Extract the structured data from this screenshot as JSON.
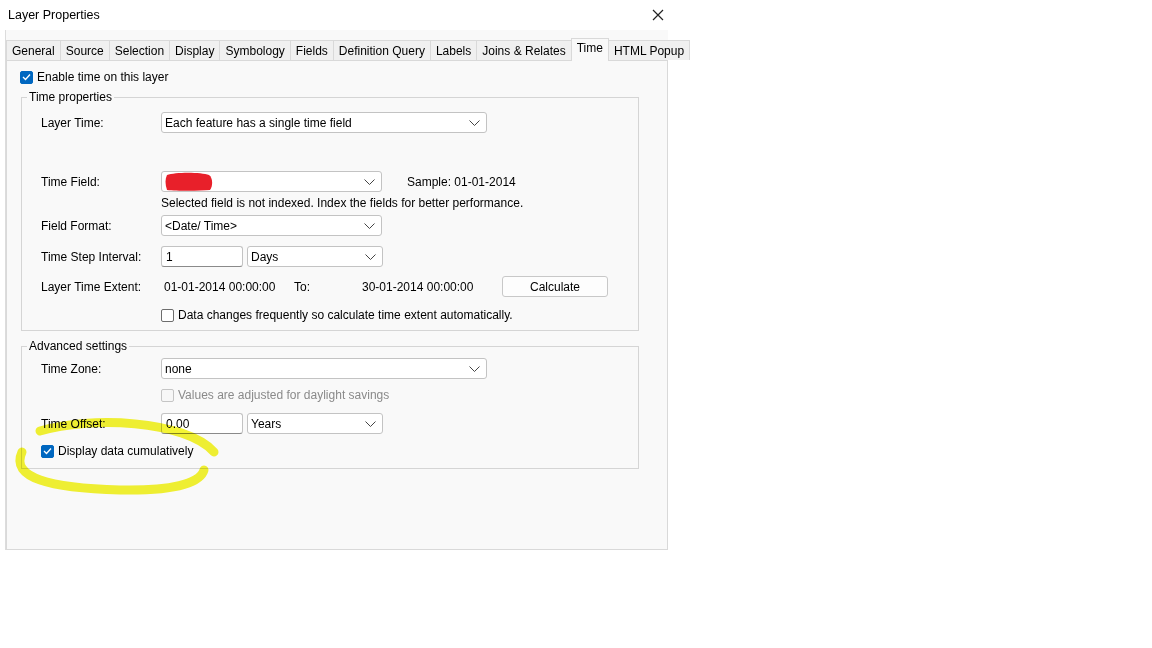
{
  "window": {
    "title": "Layer Properties"
  },
  "tabs": [
    {
      "label": "General",
      "selected": false
    },
    {
      "label": "Source",
      "selected": false
    },
    {
      "label": "Selection",
      "selected": false
    },
    {
      "label": "Display",
      "selected": false
    },
    {
      "label": "Symbology",
      "selected": false
    },
    {
      "label": "Fields",
      "selected": false
    },
    {
      "label": "Definition Query",
      "selected": false
    },
    {
      "label": "Labels",
      "selected": false
    },
    {
      "label": "Joins & Relates",
      "selected": false
    },
    {
      "label": "Time",
      "selected": true
    },
    {
      "label": "HTML Popup",
      "selected": false
    }
  ],
  "enable_time": {
    "label": "Enable time on this layer",
    "checked": true
  },
  "time_properties": {
    "title": "Time properties",
    "layer_time": {
      "label": "Layer Time:",
      "value": "Each feature has a single time field"
    },
    "time_field": {
      "label": "Time Field:",
      "value_redacted": true,
      "sample": "Sample: 01-01-2014",
      "note": "Selected field is not indexed. Index the fields for better performance."
    },
    "field_format": {
      "label": "Field Format:",
      "value": "<Date/ Time>"
    },
    "time_step_interval": {
      "label": "Time Step Interval:",
      "value": "1",
      "unit": "Days"
    },
    "layer_time_extent": {
      "label": "Layer Time Extent:",
      "from": "01-01-2014 00:00:00",
      "to_label": "To:",
      "to": "30-01-2014 00:00:00"
    },
    "calculate_button": "Calculate",
    "auto_extent": {
      "label": "Data changes frequently so calculate time extent automatically.",
      "checked": false
    }
  },
  "advanced_settings": {
    "title": "Advanced settings",
    "time_zone": {
      "label": "Time Zone:",
      "value": "none"
    },
    "daylight_savings": {
      "label": "Values are adjusted for daylight savings",
      "checked": false,
      "disabled": true
    },
    "time_offset": {
      "label": "Time Offset:",
      "value": "0.00",
      "unit": "Years"
    },
    "display_cumulatively": {
      "label": "Display data cumulatively",
      "checked": true,
      "highlighted": true
    }
  }
}
